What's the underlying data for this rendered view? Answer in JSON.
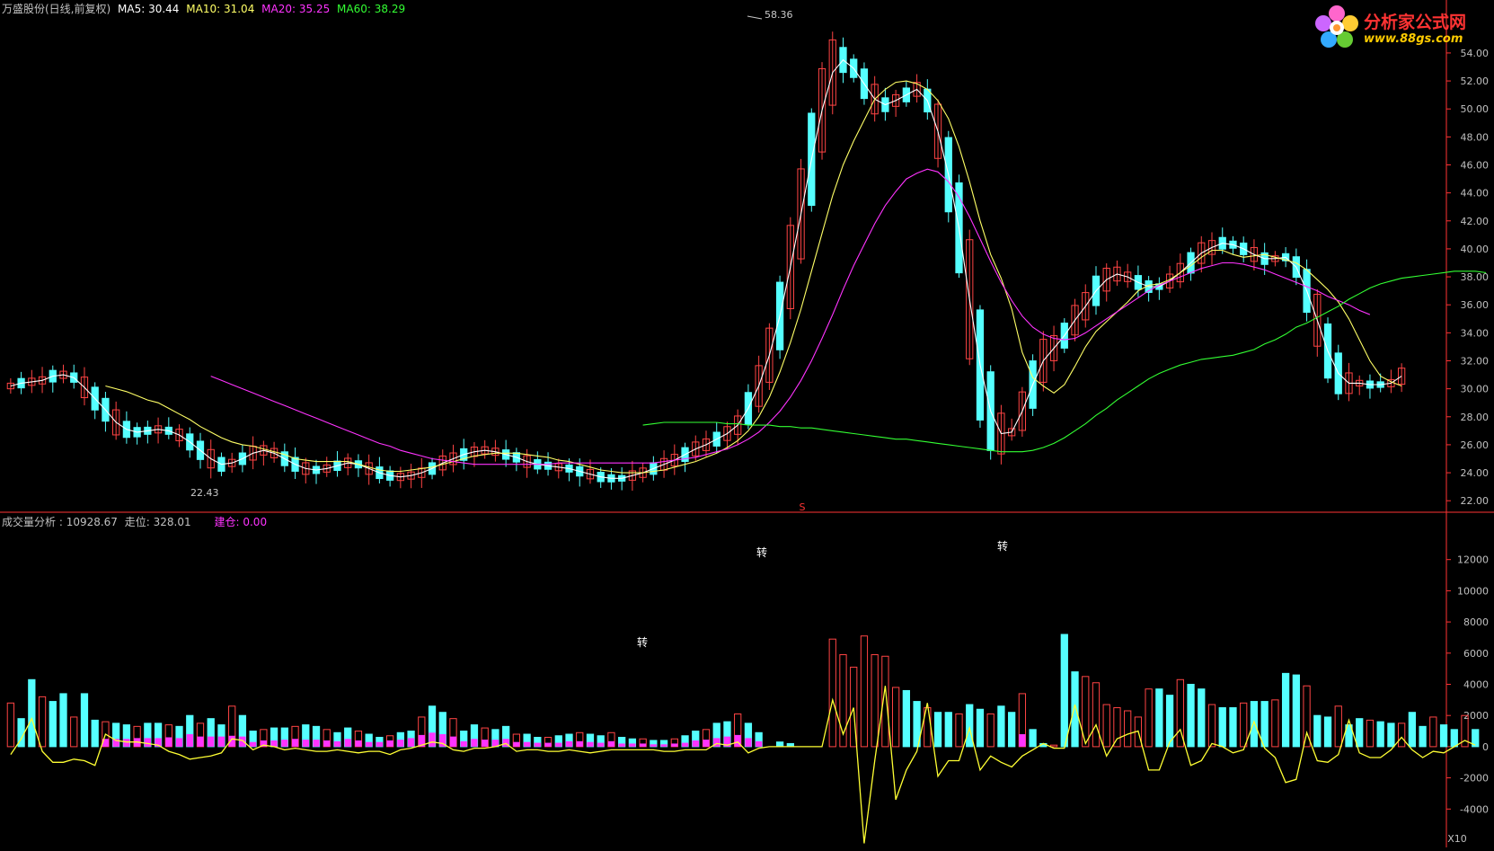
{
  "price_panel": {
    "title": "万盛股份(日线,前复权)",
    "ma_legend": [
      {
        "name": "MA5",
        "value": "30.44",
        "color": "#ffffff"
      },
      {
        "name": "MA10",
        "value": "31.04",
        "color": "#ffff66"
      },
      {
        "name": "MA20",
        "value": "35.25",
        "color": "#ff33ff"
      },
      {
        "name": "MA60",
        "value": "38.29",
        "color": "#33ff33"
      }
    ],
    "high_label": "58.36",
    "low_label": "22.43",
    "marker_label": "S"
  },
  "volume_panel": {
    "title": "成交量分析",
    "value": "10928.67",
    "walk_label": "走位",
    "walk_value": "328.01",
    "build_label": "建仓",
    "build_value": "0.00",
    "turn_label": "转",
    "scale_label": "X10"
  },
  "logo": {
    "name": "分析家公式网",
    "url": "www.88gs.com"
  },
  "colors": {
    "up": "#ff4444",
    "down": "#55ffff",
    "ma5": "#ffffff",
    "ma10": "#ffff66",
    "ma20": "#ff33ff",
    "ma60": "#33ff33",
    "walk": "#ffff33",
    "build": "#ff33ff",
    "axis": "#ff3333",
    "text": "#c0c0c0"
  },
  "chart_data": [
    {
      "type": "candlestick",
      "title": "万盛股份(日线,前复权)",
      "yticks": [
        "22.00",
        "24.00",
        "26.00",
        "28.00",
        "30.00",
        "32.00",
        "34.00",
        "36.00",
        "38.00",
        "40.00",
        "42.00",
        "44.00",
        "46.00",
        "48.00",
        "50.00",
        "52.00",
        "54.00"
      ],
      "ylim": [
        21.5,
        56.5
      ],
      "grid": false,
      "series": [
        {
          "name": "MA5",
          "values": [
            30.2,
            30.4,
            30.5,
            30.6,
            30.9,
            31.0,
            30.8,
            30.1,
            29.3,
            28.5,
            27.6,
            27.1,
            26.9,
            27.0,
            27.1,
            27.0,
            26.7,
            26.2,
            25.6,
            25.0,
            24.6,
            24.7,
            25.0,
            25.4,
            25.6,
            25.4,
            25.0,
            24.6,
            24.3,
            24.2,
            24.3,
            24.5,
            24.7,
            24.6,
            24.3,
            24.0,
            23.8,
            23.7,
            23.8,
            24.0,
            24.3,
            24.7,
            25.0,
            25.3,
            25.5,
            25.6,
            25.5,
            25.3,
            25.1,
            24.8,
            24.6,
            24.5,
            24.4,
            24.3,
            24.1,
            23.9,
            23.7,
            23.6,
            23.6,
            23.8,
            24.0,
            24.3,
            24.6,
            24.9,
            25.3,
            25.7,
            26.0,
            26.4,
            26.8,
            27.4,
            28.6,
            30.2,
            32.4,
            35.2,
            38.7,
            42.5,
            46.4,
            49.9,
            52.6,
            53.5,
            52.9,
            51.8,
            50.7,
            50.3,
            50.6,
            51.0,
            51.4,
            50.6,
            48.4,
            45.3,
            41.5,
            36.4,
            31.7,
            28.4,
            26.8,
            26.9,
            28.4,
            30.3,
            32.0,
            32.9,
            33.8,
            34.9,
            35.9,
            37.0,
            37.8,
            38.2,
            38.0,
            37.6,
            37.3,
            37.3,
            37.7,
            38.3,
            39.0,
            39.7,
            40.1,
            40.4,
            40.3,
            40.0,
            39.6,
            39.3,
            39.3,
            39.4,
            38.7,
            37.0,
            34.9,
            32.7,
            31.1,
            30.4,
            30.4,
            30.3,
            30.3,
            30.4,
            30.9
          ]
        },
        {
          "name": "MA10",
          "values": [
            null,
            null,
            null,
            null,
            null,
            null,
            null,
            null,
            null,
            30.2,
            30.0,
            29.8,
            29.5,
            29.2,
            29.0,
            28.6,
            28.2,
            27.8,
            27.3,
            26.9,
            26.5,
            26.2,
            26.0,
            25.9,
            25.7,
            25.5,
            25.3,
            25.0,
            24.9,
            24.8,
            24.8,
            24.8,
            24.8,
            24.6,
            24.4,
            24.2,
            24.1,
            24.1,
            24.2,
            24.3,
            24.4,
            24.6,
            24.8,
            25.0,
            25.2,
            25.3,
            25.4,
            25.4,
            25.4,
            25.3,
            25.2,
            25.1,
            24.9,
            24.8,
            24.6,
            24.4,
            24.2,
            24.1,
            24.0,
            24.0,
            24.0,
            24.1,
            24.2,
            24.4,
            24.6,
            24.8,
            25.1,
            25.4,
            25.8,
            26.3,
            27.0,
            28.0,
            29.4,
            31.2,
            33.3,
            35.7,
            38.4,
            41.1,
            43.8,
            46.0,
            47.7,
            49.2,
            50.7,
            51.4,
            51.9,
            52.0,
            51.8,
            51.4,
            50.6,
            49.3,
            47.3,
            44.8,
            42.0,
            39.6,
            37.9,
            35.7,
            32.6,
            30.8,
            30.2,
            29.7,
            30.3,
            31.6,
            33.0,
            34.1,
            34.8,
            35.5,
            36.2,
            37.0,
            37.4,
            37.5,
            37.8,
            38.3,
            38.8,
            39.4,
            39.9,
            39.9,
            39.6,
            39.4,
            39.5,
            39.6,
            39.4,
            39.2,
            39.0,
            38.5,
            37.8,
            37.1,
            36.2,
            35.0,
            33.5,
            32.0,
            30.9,
            30.5,
            30.2
          ]
        },
        {
          "name": "MA20",
          "values": [
            null,
            null,
            null,
            null,
            null,
            null,
            null,
            null,
            null,
            null,
            null,
            null,
            null,
            null,
            null,
            null,
            null,
            null,
            null,
            30.9,
            30.6,
            30.3,
            30.0,
            29.7,
            29.4,
            29.1,
            28.8,
            28.5,
            28.2,
            27.9,
            27.6,
            27.3,
            27.0,
            26.7,
            26.4,
            26.1,
            25.9,
            25.6,
            25.4,
            25.2,
            25.0,
            24.9,
            24.8,
            24.7,
            24.6,
            24.6,
            24.6,
            24.6,
            24.6,
            24.6,
            24.6,
            24.6,
            24.7,
            24.7,
            24.7,
            24.7,
            24.7,
            24.7,
            24.7,
            24.7,
            24.7,
            24.7,
            24.8,
            24.9,
            25.0,
            25.1,
            25.3,
            25.5,
            25.7,
            26.0,
            26.4,
            26.9,
            27.6,
            28.4,
            29.4,
            30.6,
            32.0,
            33.6,
            35.3,
            37.1,
            38.8,
            40.3,
            41.8,
            43.1,
            44.1,
            45.0,
            45.4,
            45.7,
            45.5,
            44.8,
            43.7,
            42.3,
            40.7,
            39.1,
            37.6,
            36.3,
            35.2,
            34.4,
            33.9,
            33.6,
            33.5,
            33.6,
            34.0,
            34.5,
            35.0,
            35.5,
            36.0,
            36.5,
            37.0,
            37.4,
            37.7,
            38.0,
            38.3,
            38.6,
            38.8,
            39.0,
            39.0,
            38.9,
            38.7,
            38.5,
            38.2,
            37.9,
            37.6,
            37.3,
            37.0,
            36.6,
            36.3,
            36.0,
            35.6,
            35.3
          ]
        },
        {
          "name": "MA60",
          "values": [
            null,
            null,
            null,
            null,
            null,
            null,
            null,
            null,
            null,
            null,
            null,
            null,
            null,
            null,
            null,
            null,
            null,
            null,
            null,
            null,
            null,
            null,
            null,
            null,
            null,
            null,
            null,
            null,
            null,
            null,
            null,
            null,
            null,
            null,
            null,
            null,
            null,
            null,
            null,
            null,
            null,
            null,
            null,
            null,
            null,
            null,
            null,
            null,
            null,
            null,
            null,
            null,
            null,
            null,
            null,
            null,
            null,
            null,
            null,
            null,
            27.4,
            27.5,
            27.6,
            27.6,
            27.6,
            27.6,
            27.6,
            27.6,
            27.5,
            27.5,
            27.4,
            27.4,
            27.4,
            27.3,
            27.3,
            27.2,
            27.2,
            27.1,
            27.0,
            26.9,
            26.8,
            26.7,
            26.6,
            26.5,
            26.4,
            26.4,
            26.3,
            26.2,
            26.1,
            26.0,
            25.9,
            25.8,
            25.7,
            25.6,
            25.5,
            25.5,
            25.5,
            25.6,
            25.8,
            26.1,
            26.5,
            27.0,
            27.5,
            28.1,
            28.6,
            29.2,
            29.7,
            30.2,
            30.7,
            31.1,
            31.4,
            31.7,
            31.9,
            32.1,
            32.2,
            32.3,
            32.4,
            32.6,
            32.8,
            33.2,
            33.5,
            33.9,
            34.4,
            34.7,
            35.1,
            35.5,
            35.9,
            36.4,
            36.8,
            37.2,
            37.5,
            37.7,
            37.9,
            38.0,
            38.1,
            38.2,
            38.3,
            38.4,
            38.4,
            38.4,
            38.3
          ]
        }
      ]
    },
    {
      "type": "bar",
      "title": "成交量分析",
      "yticks": [
        "-4000",
        "-2000",
        "0",
        "2000",
        "4000",
        "6000",
        "8000",
        "10000",
        "12000"
      ],
      "ylim": [
        -6000,
        14000
      ],
      "grid": false,
      "series": [
        {
          "name": "成交量分析",
          "values": [
            2800,
            1800,
            4300,
            3200,
            2900,
            3400,
            1900,
            3400,
            1700,
            1600,
            1500,
            1400,
            1300,
            1500,
            1500,
            1400,
            1300,
            2000,
            1500,
            1800,
            1400,
            2600,
            2000,
            1000,
            1100,
            1200,
            1200,
            1300,
            1400,
            1300,
            1100,
            900,
            1200,
            1000,
            800,
            600,
            700,
            900,
            1000,
            1900,
            2600,
            2200,
            1800,
            1000,
            1400,
            1200,
            1100,
            1300,
            800,
            800,
            600,
            600,
            700,
            800,
            900,
            800,
            700,
            900,
            600,
            500,
            500,
            400,
            400,
            500,
            700,
            1000,
            1100,
            1500,
            1600,
            2100,
            1500,
            900,
            0,
            300,
            200,
            0,
            0,
            0,
            6900,
            5900,
            5100,
            7100,
            5900,
            5800,
            3800,
            3600,
            2900,
            2500,
            2200,
            2200,
            2100,
            2700,
            2400,
            2100,
            2600,
            2200,
            3400,
            1100,
            200,
            100,
            7200,
            4800,
            4500,
            4100,
            2700,
            2500,
            2300,
            1900,
            3700,
            3700,
            3300,
            4300,
            4000,
            3700,
            2700,
            2500,
            2500,
            2800,
            2900,
            2900,
            3000,
            4700,
            4600,
            3900,
            2000,
            1900,
            2600,
            1400,
            1800,
            1700,
            1600,
            1500,
            1500,
            2200,
            1300,
            1900,
            1400,
            1100,
            2000,
            1100
          ]
        },
        {
          "name": "走位",
          "values": [
            -500,
            500,
            1800,
            -300,
            -1000,
            -1000,
            -800,
            -900,
            -1200,
            800,
            400,
            300,
            300,
            200,
            100,
            -300,
            -500,
            -800,
            -700,
            -600,
            -400,
            500,
            400,
            -200,
            100,
            0,
            -200,
            -100,
            -200,
            -300,
            -300,
            -200,
            -300,
            -400,
            -300,
            -300,
            -500,
            -200,
            -100,
            100,
            300,
            200,
            -200,
            -300,
            -100,
            -100,
            0,
            200,
            -300,
            -200,
            -200,
            -300,
            -300,
            -200,
            -300,
            -400,
            -300,
            -200,
            -200,
            -200,
            -200,
            -200,
            -300,
            -300,
            -200,
            -200,
            -200,
            200,
            100,
            300,
            -400,
            -100,
            0,
            0,
            0,
            0,
            0,
            0,
            3000,
            800,
            2500,
            -6200,
            -900,
            3900,
            -3400,
            -1500,
            -300,
            2800,
            -1900,
            -900,
            -900,
            1200,
            -1500,
            -600,
            -1000,
            -1300,
            -600,
            -200,
            200,
            -100,
            -100,
            2700,
            200,
            1400,
            -600,
            500,
            800,
            1000,
            -1500,
            -1500,
            300,
            1100,
            -1200,
            -900,
            200,
            0,
            -400,
            -200,
            1600,
            -100,
            -700,
            -2300,
            -2100,
            900,
            -900,
            -1000,
            -500,
            1700,
            -400,
            -700,
            -700,
            -200,
            600,
            -200,
            -700,
            -300,
            -400,
            0,
            400,
            100
          ]
        },
        {
          "name": "建仓",
          "values": [
            0,
            0,
            0,
            0,
            0,
            0,
            0,
            0,
            0,
            500,
            500,
            500,
            550,
            550,
            550,
            600,
            550,
            800,
            650,
            650,
            650,
            700,
            650,
            300,
            400,
            400,
            450,
            500,
            450,
            450,
            400,
            350,
            500,
            400,
            300,
            300,
            400,
            450,
            550,
            750,
            900,
            800,
            650,
            350,
            500,
            450,
            450,
            500,
            300,
            300,
            250,
            250,
            250,
            350,
            350,
            300,
            250,
            350,
            200,
            200,
            200,
            150,
            150,
            200,
            250,
            400,
            450,
            550,
            650,
            750,
            550,
            350,
            0,
            0,
            0,
            0,
            0,
            0,
            0,
            0,
            0,
            0,
            0,
            0,
            0,
            0,
            0,
            0,
            0,
            0,
            0,
            0,
            0,
            0,
            0,
            0,
            800,
            0,
            0,
            0,
            0,
            0,
            0,
            0,
            0,
            0,
            0,
            0,
            0,
            0,
            0,
            0,
            0,
            0,
            0,
            0,
            0,
            0,
            0,
            0,
            0,
            0,
            0,
            0,
            0,
            0,
            0,
            0,
            0,
            0,
            0,
            0,
            0,
            0,
            0,
            0,
            0,
            0,
            0,
            0
          ]
        }
      ],
      "annotations": [
        "转",
        "转",
        "转"
      ]
    }
  ]
}
